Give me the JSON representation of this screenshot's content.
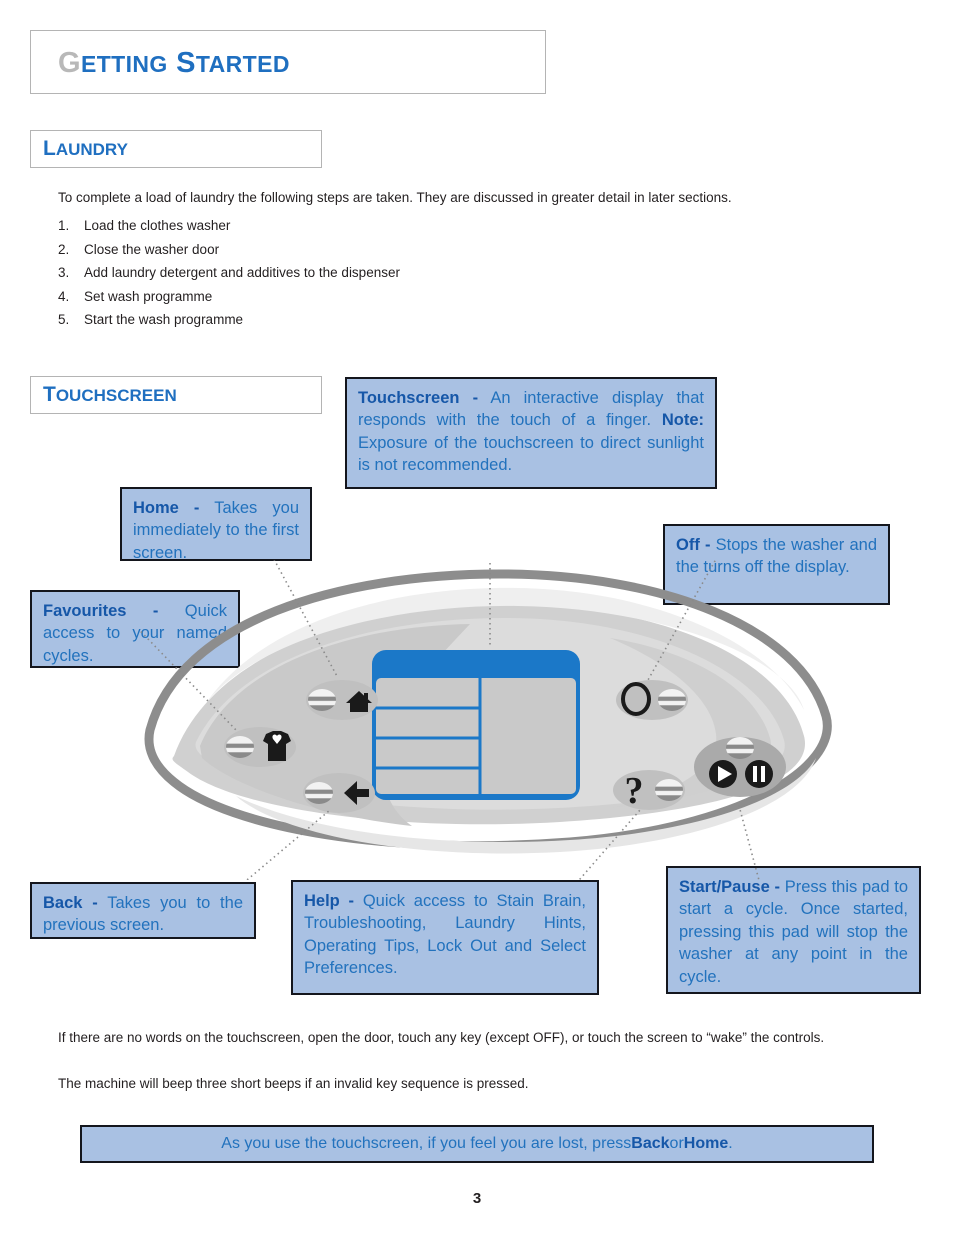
{
  "chapter": {
    "title_g": "G",
    "title_rest1": "ETTING",
    "title_s": "S",
    "title_rest2": "TARTED"
  },
  "sections": {
    "laundry": {
      "cap": "L",
      "rest": "AUNDRY"
    },
    "touchscreen": {
      "cap": "T",
      "rest": "OUCHSCREEN"
    }
  },
  "laundry": {
    "intro": "To complete a load of laundry the following steps are taken.  They are discussed in greater detail in later sections.",
    "steps": [
      {
        "num": "1.",
        "text": "Load the clothes washer"
      },
      {
        "num": "2.",
        "text": "Close the washer door"
      },
      {
        "num": "3.",
        "text": "Add laundry detergent and additives to the dispenser"
      },
      {
        "num": "4.",
        "text": "Set wash programme"
      },
      {
        "num": "5.",
        "text": "Start the wash programme"
      }
    ]
  },
  "callouts": {
    "touchscreen": {
      "term": "Touchscreen -",
      "body": " An interactive display that responds with the touch of a finger. ",
      "note_label": "Note:",
      "note_body": " Exposure of the touchscreen to direct sunlight is not recommended."
    },
    "home": {
      "term": "Home -",
      "body": " Takes you immediately to the first screen."
    },
    "favourites": {
      "term": "Favourites -",
      "body": " Quick access to your named cycles."
    },
    "off": {
      "term": "Off -",
      "body": " Stops the washer and the turns off the display."
    },
    "back": {
      "term": "Back -",
      "body": " Takes you to the previous screen."
    },
    "help": {
      "term": "Help -",
      "body": " Quick access to Stain Brain, Troubleshooting, Laundry Hints, Operating Tips, Lock Out and Select Preferences."
    },
    "start_pause": {
      "term": "Start/Pause -",
      "body": " Press this pad to start a cycle.  Once started, pressing this pad will stop the washer at any point in the cycle."
    }
  },
  "notes": {
    "wake": "If there are no words on the touchscreen, open the door, touch any key (except OFF), or touch the screen to “wake” the controls.",
    "beep": "The machine will beep three short beeps if an invalid key sequence is pressed."
  },
  "tip": {
    "part1": "As you use the touchscreen, if you feel you are lost, press ",
    "back": "Back",
    "part2": " or ",
    "home": "Home",
    "part3": "."
  },
  "footer": {
    "page_number": "3"
  },
  "diagram": {
    "labels": {
      "home_button": "home-key",
      "favourites_button": "favourites-key",
      "back_button": "back-key",
      "off_button": "off-key",
      "help_button": "help-key",
      "start_pause_button": "start-pause-key",
      "touchscreen": "touchscreen-display"
    }
  },
  "colors": {
    "accent_blue": "#1f6fc0",
    "callout_bg": "#a9c1e3",
    "callout_border": "#14161d",
    "header_border": "#b4b4b4",
    "body_text": "#231f20",
    "panel_dark_gray": "#8d8d8d",
    "panel_mid_gray": "#c9c9c9",
    "panel_light_gray": "#e3e3e3",
    "screen_blue": "#1b78c8"
  }
}
